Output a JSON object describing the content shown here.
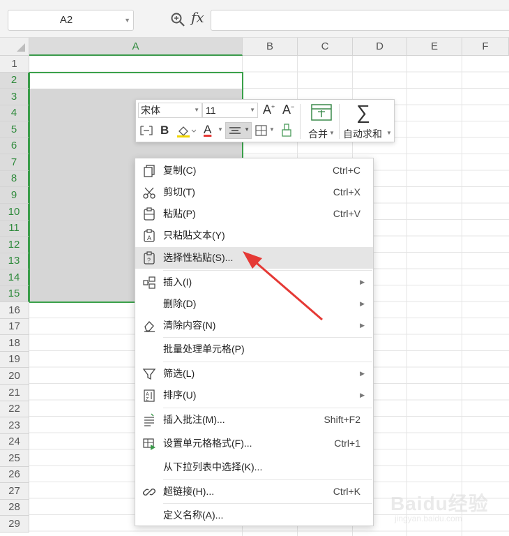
{
  "formula_bar": {
    "name_box": "A2",
    "fx": "fx"
  },
  "columns": [
    "A",
    "B",
    "C",
    "D",
    "E",
    "F"
  ],
  "rows": [
    "1",
    "2",
    "3",
    "4",
    "5",
    "6",
    "7",
    "8",
    "9",
    "10",
    "11",
    "12",
    "13",
    "14",
    "15",
    "16",
    "17",
    "18",
    "19",
    "20",
    "21",
    "22",
    "23",
    "24",
    "25",
    "26",
    "27",
    "28",
    "29"
  ],
  "mini_toolbar": {
    "font_name": "宋体",
    "font_size": "11",
    "grow_font": "A",
    "shrink_font": "A",
    "bold": "B",
    "font_color": "A",
    "merge_label": "合并",
    "autosum_label": "自动求和",
    "sigma": "∑"
  },
  "context_menu": {
    "items": [
      {
        "label": "复制(C)",
        "shortcut": "Ctrl+C"
      },
      {
        "label": "剪切(T)",
        "shortcut": "Ctrl+X"
      },
      {
        "label": "粘贴(P)",
        "shortcut": "Ctrl+V"
      },
      {
        "label": "只粘贴文本(Y)",
        "shortcut": ""
      },
      {
        "label": "选择性粘贴(S)...",
        "shortcut": ""
      },
      {
        "label": "插入(I)",
        "shortcut": ""
      },
      {
        "label": "删除(D)",
        "shortcut": ""
      },
      {
        "label": "清除内容(N)",
        "shortcut": ""
      },
      {
        "label": "批量处理单元格(P)",
        "shortcut": ""
      },
      {
        "label": "筛选(L)",
        "shortcut": ""
      },
      {
        "label": "排序(U)",
        "shortcut": ""
      },
      {
        "label": "插入批注(M)...",
        "shortcut": "Shift+F2"
      },
      {
        "label": "设置单元格格式(F)...",
        "shortcut": "Ctrl+1"
      },
      {
        "label": "从下拉列表中选择(K)...",
        "shortcut": ""
      },
      {
        "label": "超链接(H)...",
        "shortcut": "Ctrl+K"
      },
      {
        "label": "定义名称(A)...",
        "shortcut": ""
      }
    ]
  },
  "watermark": {
    "brand": "Baidu经验",
    "url": "jingyan.baidu.com"
  },
  "colors": {
    "selection_green": "#3aa14a",
    "arrow_red": "#e53935",
    "highlight": "#e5e5e5"
  }
}
